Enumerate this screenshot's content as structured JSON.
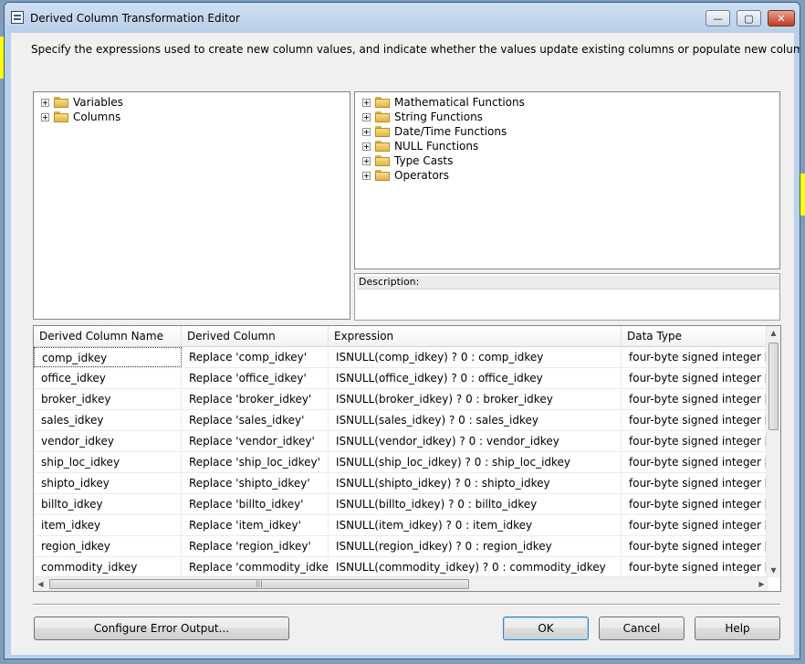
{
  "window": {
    "title": "Derived Column Transformation Editor",
    "minimize_glyph": "—",
    "maximize_glyph": "▢",
    "close_glyph": "✕"
  },
  "instructions": "Specify the expressions used to create new column values, and indicate whether the values update existing columns or populate new columns.",
  "left_tree": [
    {
      "label": "Variables",
      "icon": "folder-icon"
    },
    {
      "label": "Columns",
      "icon": "folder-icon"
    }
  ],
  "right_tree": [
    {
      "label": "Mathematical Functions",
      "icon": "folder-icon"
    },
    {
      "label": "String Functions",
      "icon": "folder-icon"
    },
    {
      "label": "Date/Time Functions",
      "icon": "folder-icon"
    },
    {
      "label": "NULL Functions",
      "icon": "folder-icon"
    },
    {
      "label": "Type Casts",
      "icon": "folder-icon"
    },
    {
      "label": "Operators",
      "icon": "folder-icon"
    }
  ],
  "description_label": "Description:",
  "grid": {
    "headers": [
      "Derived Column Name",
      "Derived Column",
      "Expression",
      "Data Type"
    ],
    "rows": [
      [
        "comp_idkey",
        "Replace 'comp_idkey'",
        "ISNULL(comp_idkey) ? 0 : comp_idkey",
        "four-byte signed integer [..."
      ],
      [
        "office_idkey",
        "Replace 'office_idkey'",
        "ISNULL(office_idkey) ? 0 : office_idkey",
        "four-byte signed integer [..."
      ],
      [
        "broker_idkey",
        "Replace 'broker_idkey'",
        "ISNULL(broker_idkey) ? 0 : broker_idkey",
        "four-byte signed integer [..."
      ],
      [
        "sales_idkey",
        "Replace 'sales_idkey'",
        "ISNULL(sales_idkey) ? 0 : sales_idkey",
        "four-byte signed integer [..."
      ],
      [
        "vendor_idkey",
        "Replace 'vendor_idkey'",
        "ISNULL(vendor_idkey) ? 0 : vendor_idkey",
        "four-byte signed integer [..."
      ],
      [
        "ship_loc_idkey",
        "Replace 'ship_loc_idkey'",
        "ISNULL(ship_loc_idkey) ? 0 : ship_loc_idkey",
        "four-byte signed integer [..."
      ],
      [
        "shipto_idkey",
        "Replace 'shipto_idkey'",
        "ISNULL(shipto_idkey) ? 0 : shipto_idkey",
        "four-byte signed integer [..."
      ],
      [
        "billto_idkey",
        "Replace 'billto_idkey'",
        "ISNULL(billto_idkey) ? 0 : billto_idkey",
        "four-byte signed integer [..."
      ],
      [
        "item_idkey",
        "Replace 'item_idkey'",
        "ISNULL(item_idkey) ? 0 : item_idkey",
        "four-byte signed integer [..."
      ],
      [
        "region_idkey",
        "Replace 'region_idkey'",
        "ISNULL(region_idkey) ? 0 : region_idkey",
        "four-byte signed integer [..."
      ],
      [
        "commodity_idkey",
        "Replace 'commodity_idkey'",
        "ISNULL(commodity_idkey) ? 0 : commodity_idkey",
        "four-byte signed integer [..."
      ]
    ]
  },
  "buttons": {
    "configure_error_output": "Configure Error Output...",
    "ok": "OK",
    "cancel": "Cancel",
    "help": "Help"
  },
  "colors": {
    "title_bar": "#b9d1ea",
    "client": "#f0f0f0",
    "close_button": "#c23b22",
    "folder": "#f8dd85"
  }
}
